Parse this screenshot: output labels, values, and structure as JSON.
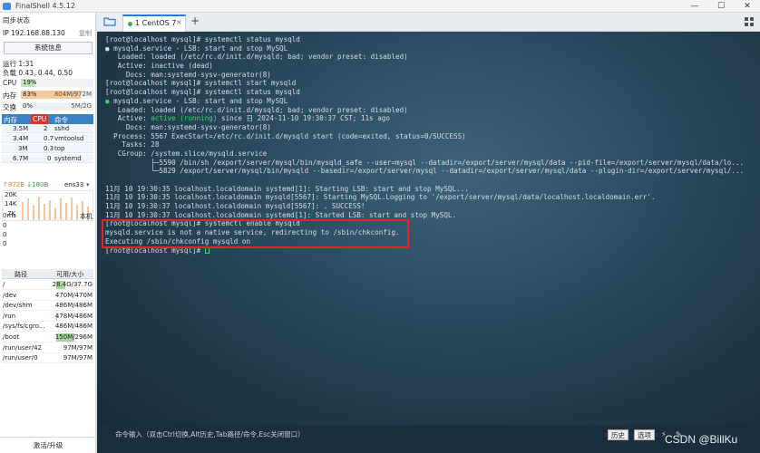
{
  "app": {
    "title": "FinalShell 4.5.12",
    "min": "—",
    "max": "☐",
    "close": "✕"
  },
  "sidebar": {
    "sync_status": "同步状态",
    "ip_label": "IP",
    "ip": "192.168.88.130",
    "copy": "复制",
    "sysinfo_button": "系统信息",
    "uptime": "运行 1:31",
    "load": "负载 0.43, 0.44, 0.50",
    "cpu": {
      "label": "CPU",
      "pct": "19%",
      "fraction": 0.19
    },
    "mem": {
      "label": "内存",
      "pct": "83%",
      "value": "804M/972M",
      "fraction": 0.83
    },
    "swap": {
      "label": "交换",
      "pct": "0%",
      "value": "5M/2G",
      "fraction": 0.0
    },
    "proc_headers": [
      "内存",
      "CPU",
      "命令"
    ],
    "processes": [
      {
        "mem": "3.5M",
        "cpu": "2",
        "cmd": "sshd"
      },
      {
        "mem": "3.4M",
        "cpu": "0.7",
        "cmd": "vmtoolsd"
      },
      {
        "mem": "3M",
        "cpu": "0.3",
        "cmd": "top"
      },
      {
        "mem": "6.7M",
        "cpu": "0",
        "cmd": "systemd"
      }
    ],
    "net": {
      "up": "↑972B",
      "down": "↓180B",
      "iface": "ens33",
      "ticks": [
        "20K",
        "14K",
        "7K"
      ]
    },
    "latency": {
      "value": "0ms",
      "host": "本机",
      "rows": [
        "0",
        "0",
        "0"
      ]
    },
    "disk_headers": [
      "路径",
      "可用/大小"
    ],
    "disks": [
      {
        "path": "/",
        "size": "28.4G/37.7G",
        "fraction": 0.25
      },
      {
        "path": "/dev",
        "size": "470M/470M",
        "fraction": 0.0
      },
      {
        "path": "/dev/shm",
        "size": "486M/486M",
        "fraction": 0.0
      },
      {
        "path": "/run",
        "size": "478M/486M",
        "fraction": 0.02
      },
      {
        "path": "/sys/fs/cgro...",
        "size": "486M/486M",
        "fraction": 0.0
      },
      {
        "path": "/boot",
        "size": "150M/296M",
        "fraction": 0.49
      },
      {
        "path": "/run/user/42",
        "size": "97M/97M",
        "fraction": 0.0
      },
      {
        "path": "/run/user/0",
        "size": "97M/97M",
        "fraction": 0.0
      }
    ],
    "footer": "激活/升级"
  },
  "tabs": [
    {
      "label": "1 CentOS 7",
      "close": "×"
    }
  ],
  "tab_add": "+",
  "terminal": {
    "lines": [
      {
        "t": "[root@localhost mysql]# systemctl status mysqld"
      },
      {
        "t": "● mysqld.service - LSB: start and stop MySQL"
      },
      {
        "t": "   Loaded: loaded (/etc/rc.d/init.d/mysqld; bad; vendor preset: disabled)"
      },
      {
        "t": "   Active: inactive (dead)"
      },
      {
        "t": "     Docs: man:systemd-sysv-generator(8)"
      },
      {
        "t": "[root@localhost mysql]# systemctl start mysqld"
      },
      {
        "t": "[root@localhost mysql]# systemctl status mysqld"
      },
      {
        "t": "● mysqld.service - LSB: start and stop MySQL",
        "bullet": "green"
      },
      {
        "t": "   Loaded: loaded (/etc/rc.d/init.d/mysqld; bad; vendor preset: disabled)"
      },
      {
        "pre": "   Active: ",
        "green": "active (running)",
        "post": " since 日 2024-11-10 19:30:37 CST; 11s ago"
      },
      {
        "t": "     Docs: man:systemd-sysv-generator(8)"
      },
      {
        "t": "  Process: 5567 ExecStart=/etc/rc.d/init.d/mysqld start (code=exited, status=0/SUCCESS)"
      },
      {
        "t": "    Tasks: 28"
      },
      {
        "t": "   CGroup: /system.slice/mysqld.service"
      },
      {
        "t": "           ├─5590 /bin/sh /export/server/mysql/bin/mysqld_safe --user=mysql --datadir=/export/server/mysql/data --pid-file=/export/server/mysql/data/lo..."
      },
      {
        "t": "           └─5829 /export/server/mysql/bin/mysqld --basedir=/export/server/mysql --datadir=/export/server/mysql/data --plugin-dir=/export/server/mysql/..."
      },
      {
        "t": ""
      },
      {
        "t": "11月 10 19:30:35 localhost.localdomain systemd[1]: Starting LSB: start and stop MySQL..."
      },
      {
        "t": "11月 10 19:30:35 localhost.localdomain mysqld[5567]: Starting MySQL.Logging to '/export/server/mysql/data/localhost.localdomain.err'."
      },
      {
        "t": "11月 10 19:30:37 localhost.localdomain mysqld[5567]: . SUCCESS!"
      },
      {
        "t": "11月 10 19:30:37 localhost.localdomain systemd[1]: Started LSB: start and stop MySQL."
      },
      {
        "t": "[root@localhost mysql]# systemctl enable mysqld"
      },
      {
        "t": "mysqld.service is not a native service, redirecting to /sbin/chkconfig."
      },
      {
        "t": "Executing /sbin/chkconfig mysqld on"
      },
      {
        "t": "[root@localhost mysql]# ",
        "cursor": true
      }
    ]
  },
  "cmdbar": {
    "placeholder": "命令输入（双击Ctrl切换,Alt历史,Tab路径/命令,Esc关闭窗口）",
    "history": "历史",
    "options": "选项"
  },
  "watermark": "CSDN @BillKu",
  "colors": {
    "accent": "#2e7bd1",
    "cpu_tab": "#d9342b",
    "terminal_green": "#3ad36a",
    "highlight": "#e0262b"
  }
}
